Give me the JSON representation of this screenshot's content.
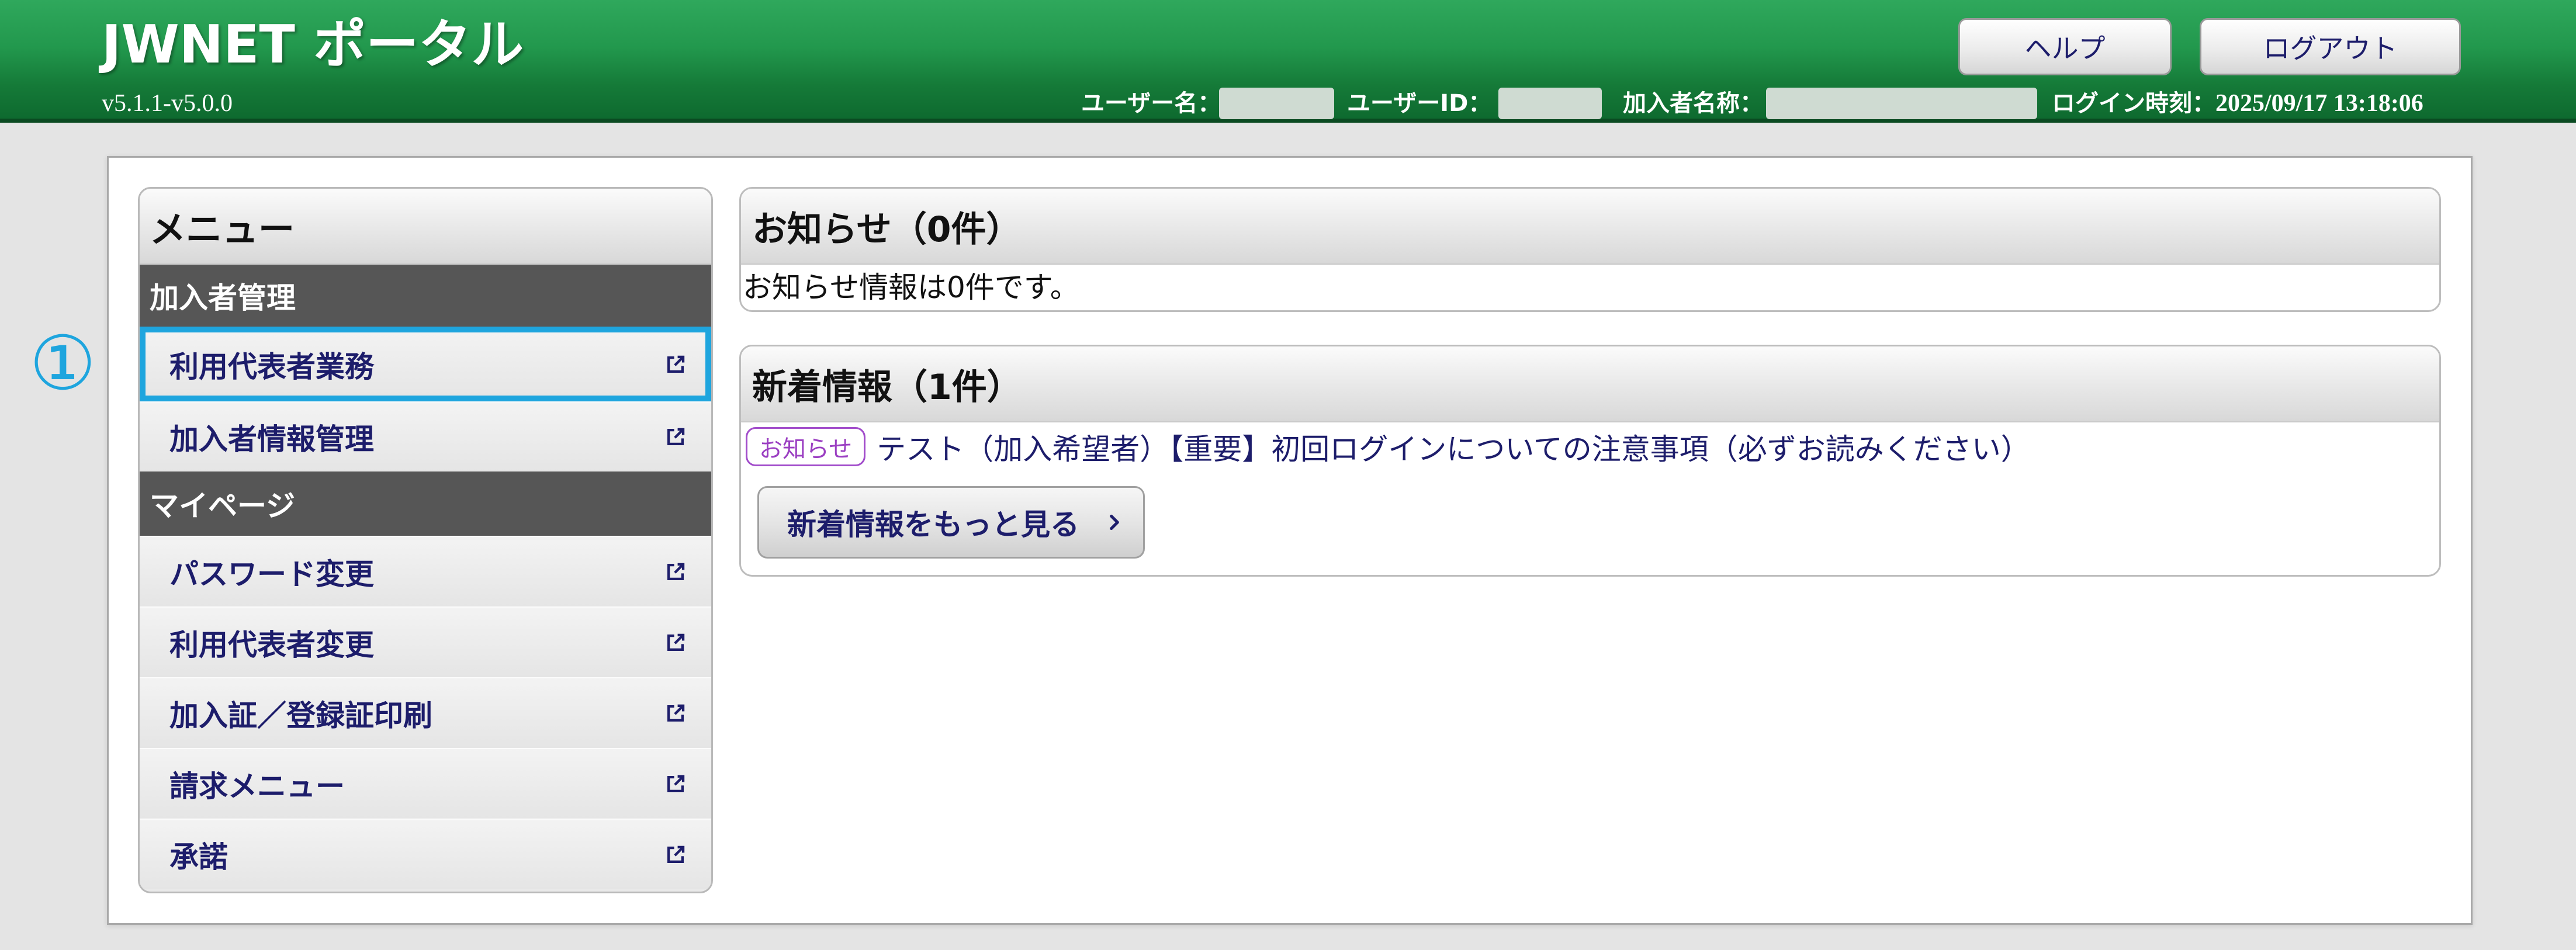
{
  "header": {
    "title": "JWNET ポータル",
    "version": "v5.1.1-v5.0.0",
    "buttons": {
      "help": "ヘルプ",
      "logout": "ログアウト"
    },
    "user_name_label": "ユーザー名：",
    "user_id_label": "ユーザーID：",
    "member_name_label": "加入者名称：",
    "login_time_label": "ログイン時刻：",
    "login_time_value": "2025/09/17 13:18:06"
  },
  "annotation": {
    "marker": "①"
  },
  "menu": {
    "title": "メニュー",
    "sections": [
      {
        "label": "加入者管理",
        "items": [
          {
            "label": "利用代表者業務",
            "icon": "external-link-icon",
            "highlighted": true
          },
          {
            "label": "加入者情報管理",
            "icon": "external-link-icon"
          }
        ]
      },
      {
        "label": "マイページ",
        "items": [
          {
            "label": "パスワード変更",
            "icon": "external-link-icon"
          },
          {
            "label": "利用代表者変更",
            "icon": "external-link-icon"
          },
          {
            "label": "加入証／登録証印刷",
            "icon": "external-link-icon"
          },
          {
            "label": "請求メニュー",
            "icon": "external-link-icon"
          },
          {
            "label": "承諾",
            "icon": "external-link-icon"
          }
        ]
      }
    ]
  },
  "notices": {
    "title": "お知らせ（0件）",
    "empty_message": "お知らせ情報は0件です。"
  },
  "news": {
    "title": "新着情報（1件）",
    "items": [
      {
        "badge": "お知らせ",
        "text": "テスト（加入希望者）【重要】初回ログインについての注意事項（必ずお読みください）"
      }
    ],
    "more_button": {
      "label": "新着情報をもっと見る",
      "icon": "chevron-right-icon"
    }
  },
  "colors": {
    "header_green": "#22984d",
    "accent_cyan": "#1ea5de",
    "link_navy": "#1d1d6b",
    "badge_purple": "#9b3fc2",
    "section_gray": "#565656"
  }
}
